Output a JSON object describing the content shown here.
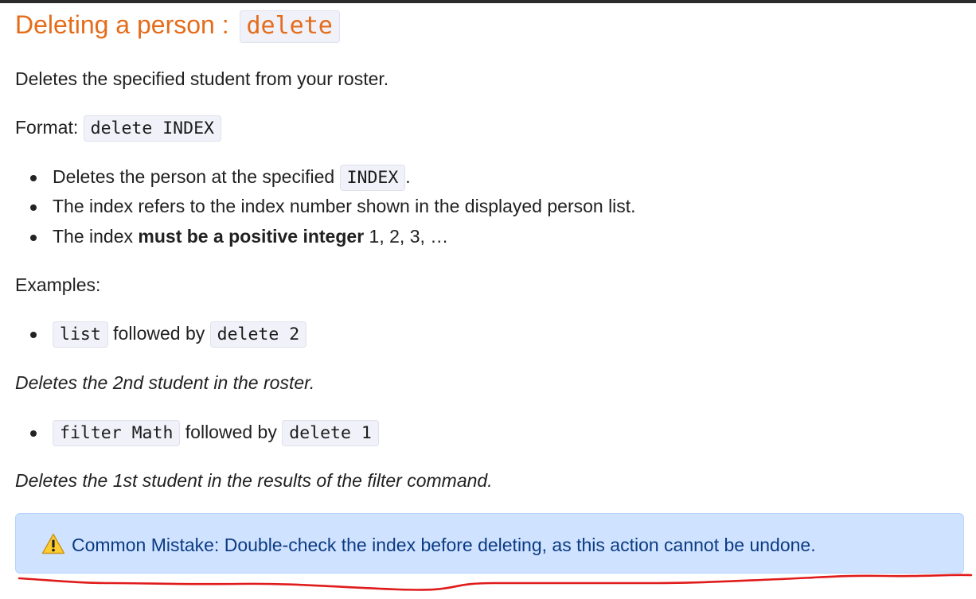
{
  "heading": {
    "text": "Deleting a person : ",
    "command": "delete"
  },
  "description": "Deletes the specified student from your roster.",
  "format": {
    "label": "Format: ",
    "code": "delete INDEX"
  },
  "rules": [
    {
      "pre": "Deletes the person at the specified ",
      "code": "INDEX",
      "post": "."
    },
    {
      "text": "The index refers to the index number shown in the displayed person list."
    },
    {
      "pre": "The index ",
      "bold": "must be a positive integer",
      "post": " 1, 2, 3, …"
    }
  ],
  "examples_label": "Examples:",
  "examples": [
    {
      "code1": "list",
      "middle": " followed by ",
      "code2": "delete 2",
      "note": "Deletes the 2nd student in the roster."
    },
    {
      "code1": "filter Math",
      "middle": " followed by ",
      "code2": "delete 1",
      "note": "Deletes the 1st student in the results of the filter command."
    }
  ],
  "callout": {
    "icon": "warning-icon",
    "text": "Common Mistake: Double-check the index before deleting, as this action cannot be undone."
  },
  "colors": {
    "heading": "#e46c1a",
    "callout_bg": "#cfe2ff",
    "callout_text": "#0b3b82",
    "annotation": "#e01b1b"
  }
}
